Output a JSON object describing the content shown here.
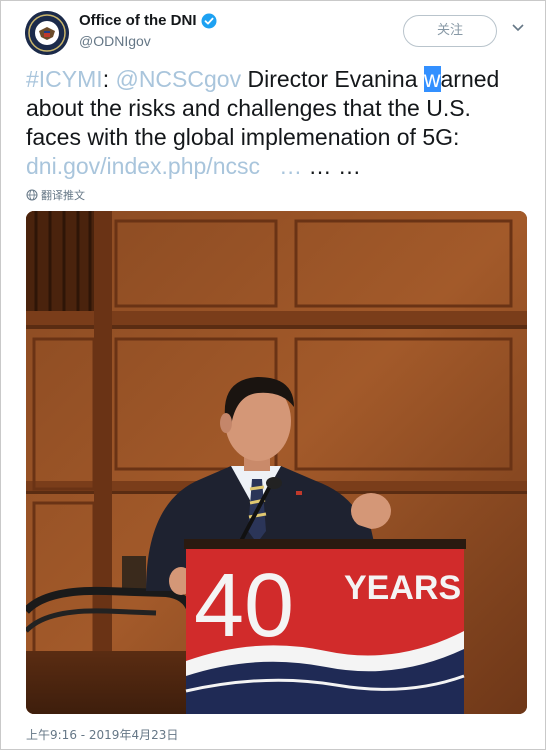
{
  "header": {
    "display_name": "Office of the DNI",
    "handle": "@ODNIgov",
    "follow_label": "关注",
    "verified_icon": "verified-badge-icon",
    "menu_icon": "chevron-down-icon"
  },
  "tweet": {
    "hashtag": "#ICYMI",
    "colon": ": ",
    "mention": "@NCSCgov",
    "text_before_sel": " Director Evanina ",
    "selected_char": "w",
    "text_after_sel": "arned about the risks and challenges that the U.S. faces with the global implemenation of 5G: ",
    "link": "dni.gov/index.php/ncsc",
    "link_ellipsis": "…",
    "trailing_ellipsis": " … …"
  },
  "translate_label": "翻译推文",
  "media": {
    "podium_number": "40",
    "podium_word": "YEARS"
  },
  "timestamp": "上午9:16 - 2019年4月23日",
  "colors": {
    "link": "#a9c5dc",
    "selection": "#3390ff",
    "podium_red": "#d12b2b",
    "podium_navy": "#1f2a55"
  }
}
